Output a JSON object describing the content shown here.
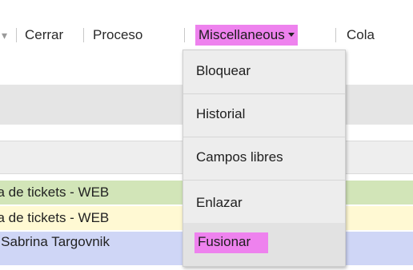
{
  "menubar": {
    "items": [
      {
        "label": "Cerrar"
      },
      {
        "label": "Proceso"
      },
      {
        "label": "Miscellaneous"
      },
      {
        "label": "Cola"
      }
    ],
    "active_color": "#ee82ee"
  },
  "rows": [
    {
      "text": "na de tickets - WEB",
      "color": "#d2e5b8"
    },
    {
      "text": "na de tickets - WEB",
      "color": "#fff9d3"
    },
    {
      "text": "e Sabrina Targovnik",
      "color": "#cfd6f6"
    }
  ],
  "dropdown": {
    "items": [
      {
        "label": "Bloquear"
      },
      {
        "label": "Historial"
      },
      {
        "label": "Campos libres"
      },
      {
        "label": "Enlazar"
      },
      {
        "label": "Fusionar"
      }
    ],
    "highlighted": "Fusionar"
  }
}
